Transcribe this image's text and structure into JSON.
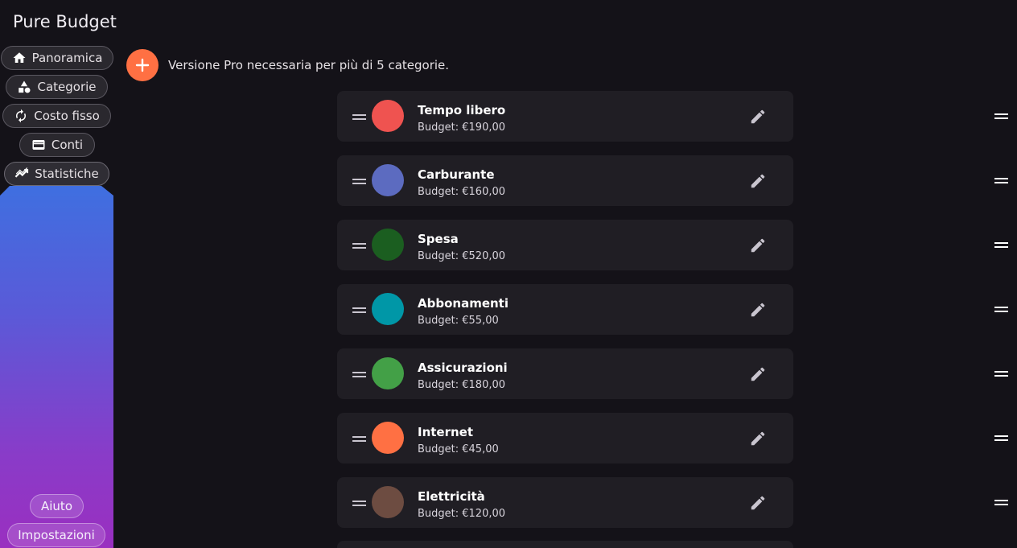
{
  "app": {
    "title": "Pure Budget"
  },
  "nav": {
    "items": [
      {
        "label": "Panoramica",
        "icon": "home-icon"
      },
      {
        "label": "Categorie",
        "icon": "shapes-icon"
      },
      {
        "label": "Costo fisso",
        "icon": "autorenew-icon"
      },
      {
        "label": "Conti",
        "icon": "wallet-icon"
      },
      {
        "label": "Statistiche",
        "icon": "insights-icon",
        "active": true
      }
    ],
    "bottom": [
      {
        "label": "Aiuto"
      },
      {
        "label": "Impostazioni"
      }
    ]
  },
  "banner": {
    "message": "Versione Pro necessaria per più di 5 categorie."
  },
  "categories": [
    {
      "name": "Tempo libero",
      "budget": "Budget: €190,00",
      "color": "#ef5350"
    },
    {
      "name": "Carburante",
      "budget": "Budget: €160,00",
      "color": "#5c6bc0"
    },
    {
      "name": "Spesa",
      "budget": "Budget: €520,00",
      "color": "#1b5e20"
    },
    {
      "name": "Abbonamenti",
      "budget": "Budget: €55,00",
      "color": "#0097a7"
    },
    {
      "name": "Assicurazioni",
      "budget": "Budget: €180,00",
      "color": "#43a047"
    },
    {
      "name": "Internet",
      "budget": "Budget: €45,00",
      "color": "#ff7043"
    },
    {
      "name": "Elettricità",
      "budget": "Budget: €120,00",
      "color": "#6d4c41"
    }
  ],
  "colors": {
    "background": "#141218",
    "card": "#201e24",
    "accent": "#ff7043"
  }
}
